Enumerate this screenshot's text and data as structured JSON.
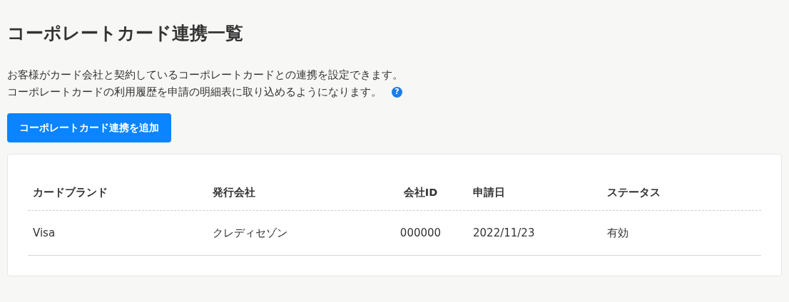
{
  "title": "コーポレートカード連携一覧",
  "description": [
    "お客様がカード会社と契約しているコーポレートカードとの連携を設定できます。",
    "コーポレートカードの利用履歴を申請の明細表に取り込めるようになります。"
  ],
  "help_icon": "?",
  "add_button": "コーポレートカード連携を追加",
  "table": {
    "columns": [
      "カードブランド",
      "発行会社",
      "会社ID",
      "申請日",
      "ステータス"
    ],
    "rows": [
      [
        "Visa",
        "クレディセゾン",
        "000000",
        "2022/11/23",
        "有効"
      ]
    ]
  }
}
